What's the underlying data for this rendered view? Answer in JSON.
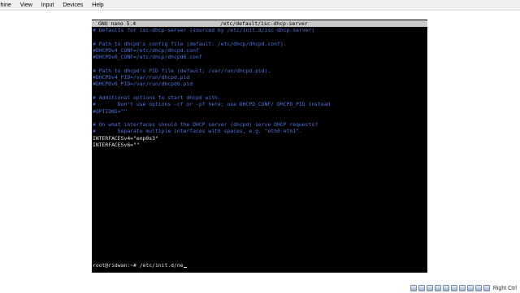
{
  "menubar": {
    "items": [
      "chine",
      "View",
      "Input",
      "Devices",
      "Help"
    ]
  },
  "nano": {
    "app_title": "GNU nano 5.4",
    "file_path": "/etc/default/isc-dhcp-server"
  },
  "editor_lines": [
    {
      "text": "# Defaults for isc-dhcp-server (sourced by /etc/init.d/isc-dhcp-server)",
      "kind": "comment"
    },
    {
      "text": "",
      "kind": "blank"
    },
    {
      "text": "# Path to dhcpd's config file (default: /etc/dhcp/dhcpd.conf).",
      "kind": "comment"
    },
    {
      "text": "#DHCPDv4_CONF=/etc/dhcp/dhcpd.conf",
      "kind": "comment"
    },
    {
      "text": "#DHCPDv6_CONF=/etc/dhcp/dhcpd6.conf",
      "kind": "comment"
    },
    {
      "text": "",
      "kind": "blank"
    },
    {
      "text": "# Path to dhcpd's PID file (default: /var/run/dhcpd.pid).",
      "kind": "comment"
    },
    {
      "text": "#DHCPDv4_PID=/var/run/dhcpd.pid",
      "kind": "comment"
    },
    {
      "text": "#DHCPDv6_PID=/var/run/dhcpd6.pid",
      "kind": "comment"
    },
    {
      "text": "",
      "kind": "blank"
    },
    {
      "text": "# Additional options to start dhcpd with.",
      "kind": "comment"
    },
    {
      "text": "#       Don't use options -cf or -pf here; use DHCPD_CONF/ DHCPD_PID instead",
      "kind": "comment"
    },
    {
      "text": "#OPTIONS=\"\"",
      "kind": "comment"
    },
    {
      "text": "",
      "kind": "blank"
    },
    {
      "text": "# On what interfaces should the DHCP server (dhcpd) serve DHCP requests?",
      "kind": "comment"
    },
    {
      "text": "#       Separate multiple interfaces with spaces, e.g. \"eth0 eth1\".",
      "kind": "comment"
    },
    {
      "text": "INTERFACESv4=\"enp0s3\"",
      "kind": "setting"
    },
    {
      "text": "INTERFACESv6=\"\"",
      "kind": "setting"
    }
  ],
  "shell": {
    "prompt": "root@ridwan:~# /etc/init.d/ne"
  },
  "status_tray": {
    "icons": [
      "hard-disk-icon",
      "optical-drive-icon",
      "audio-icon",
      "network-icon",
      "usb-icon",
      "shared-folder-icon",
      "display-icon",
      "video-capture-icon",
      "cpu-icon",
      "mouse-integration-icon"
    ],
    "host_key": "Right Ctrl"
  },
  "colors": {
    "comment": "#4f72e0",
    "titlebar": "#c9c9c9",
    "terminal_bg": "#000000"
  }
}
